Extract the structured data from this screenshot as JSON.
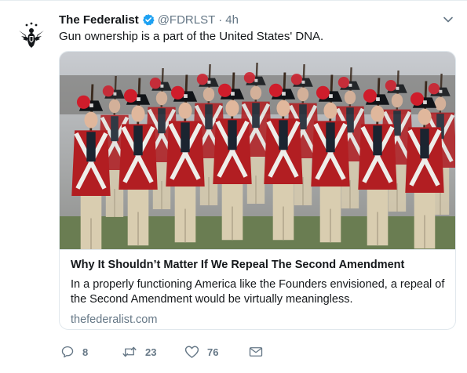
{
  "tweet": {
    "display_name": "The Federalist",
    "handle": "@FDRLST",
    "separator": "·",
    "timestamp": "4h",
    "text": "Gun ownership is a part of the United States' DNA.",
    "verified": true,
    "avatar_icon": "eagle-logo-icon"
  },
  "card": {
    "title": "Why It Shouldn’t Matter If We Repeal The Second Amendment",
    "description": "In a properly functioning America like the Founders envisioned, a repeal of the Second Amendment would be virtually meaningless.",
    "domain": "thefederalist.com",
    "image_subject": "redcoat-reenactors-photo"
  },
  "actions": {
    "reply_count": "8",
    "retweet_count": "23",
    "like_count": "76",
    "reply_icon": "reply-icon",
    "retweet_icon": "retweet-icon",
    "like_icon": "heart-icon",
    "dm_icon": "envelope-icon"
  },
  "colors": {
    "text": "#14171a",
    "secondary": "#657786",
    "verified": "#1da1f2",
    "border": "#e1e8ed"
  }
}
